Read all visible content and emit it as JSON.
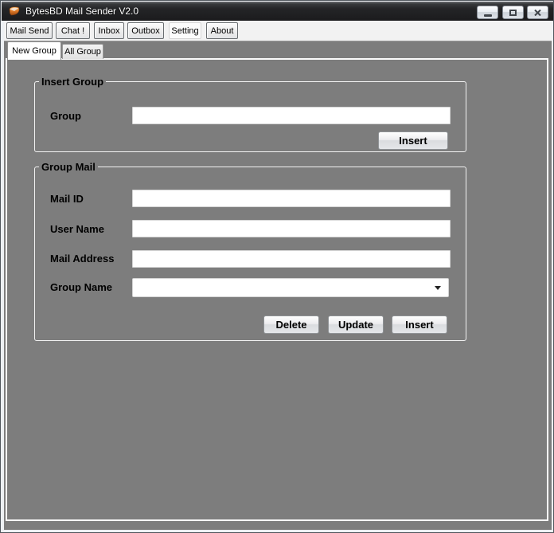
{
  "window": {
    "title": "BytesBD Mail Sender V2.0",
    "icons": {
      "app": "mail-app-icon",
      "minimize": "minimize-icon",
      "maximize": "maximize-icon",
      "close": "close-icon"
    }
  },
  "toolbar": {
    "items": [
      {
        "label": "Mail Send",
        "active": false
      },
      {
        "label": "Chat !",
        "active": false
      },
      {
        "label": "Inbox",
        "active": false
      },
      {
        "label": "Outbox",
        "active": false
      },
      {
        "label": "Setting",
        "active": true
      },
      {
        "label": "About",
        "active": false
      }
    ]
  },
  "tabs": [
    {
      "label": "New Group",
      "active": true
    },
    {
      "label": "All Group",
      "active": false
    }
  ],
  "insert_group": {
    "legend": "Insert Group",
    "group_label": "Group",
    "group_value": "",
    "insert_button": "Insert"
  },
  "group_mail": {
    "legend": "Group Mail",
    "mail_id_label": "Mail ID",
    "mail_id_value": "",
    "user_name_label": "User Name",
    "user_name_value": "",
    "mail_address_label": "Mail Address",
    "mail_address_value": "",
    "group_name_label": "Group Name",
    "group_name_value": "",
    "delete_button": "Delete",
    "update_button": "Update",
    "insert_button": "Insert"
  },
  "colors": {
    "form_background": "#7d7d7d",
    "titlebar": "#1b1b1d",
    "toolbar_background": "#f2f2f2",
    "accent_icon_orange": "#d2691e",
    "groupbox_border": "#f2f2f2"
  }
}
